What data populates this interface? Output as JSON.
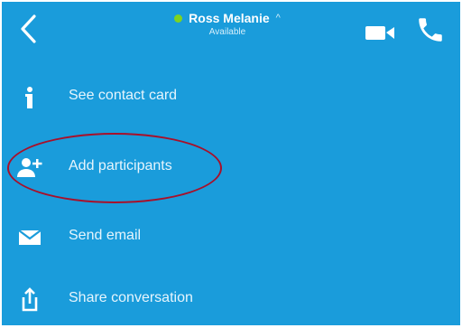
{
  "header": {
    "contact_name": "Ross Melanie",
    "caret": "^",
    "status": "Available",
    "presence_color": "#7ed321"
  },
  "menu": {
    "items": [
      {
        "label": "See contact card",
        "icon": "info-icon"
      },
      {
        "label": "Add participants",
        "icon": "add-person-icon"
      },
      {
        "label": "Send email",
        "icon": "envelope-icon"
      },
      {
        "label": "Share conversation",
        "icon": "share-icon"
      }
    ]
  },
  "colors": {
    "background": "#1a9cdb",
    "annotation": "#a8102a"
  }
}
